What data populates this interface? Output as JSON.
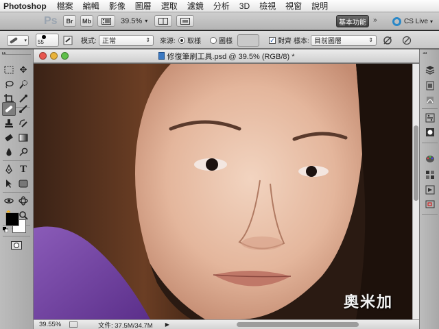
{
  "menubar": {
    "app": "Photoshop",
    "items": [
      "檔案",
      "編輯",
      "影像",
      "圖層",
      "選取",
      "濾鏡",
      "分析",
      "3D",
      "檢視",
      "視窗",
      "說明"
    ]
  },
  "appbar": {
    "logo": "Ps",
    "bridge_label": "Br",
    "minibridge_label": "Mb",
    "zoom_value": "39.5%",
    "workspace_label": "基本功能",
    "expand_label": "»",
    "cs_live_label": "CS Live"
  },
  "options": {
    "brush_size": "55",
    "mode_label": "模式:",
    "mode_value": "正常",
    "source_label": "來源:",
    "source_sampled": "取樣",
    "source_pattern": "圖樣",
    "aligned_label": "對齊",
    "sample_label": "樣本:",
    "sample_value": "目前圖層",
    "aligned_checked": true
  },
  "document": {
    "title": "修復筆刷工具.psd @ 39.5% (RGB/8) *",
    "zoom": "39.55%",
    "file_info": "文件: 37.5M/34.7M"
  },
  "watermark": "奧米加",
  "colors": {
    "foreground": "#000000",
    "background": "#ffffff",
    "accent": "#2a88c8"
  },
  "toolbox": {
    "tools": [
      "move-tool",
      "marquee-tool",
      "lasso-tool",
      "quick-select-tool",
      "crop-tool",
      "eyedropper-tool",
      "healing-brush-tool",
      "brush-tool",
      "clone-stamp-tool",
      "history-brush-tool",
      "eraser-tool",
      "gradient-tool",
      "blur-tool",
      "dodge-tool",
      "pen-tool",
      "type-tool",
      "path-select-tool",
      "shape-tool",
      "3d-rotate-tool",
      "3d-orbit-tool",
      "hand-tool",
      "zoom-tool"
    ]
  }
}
